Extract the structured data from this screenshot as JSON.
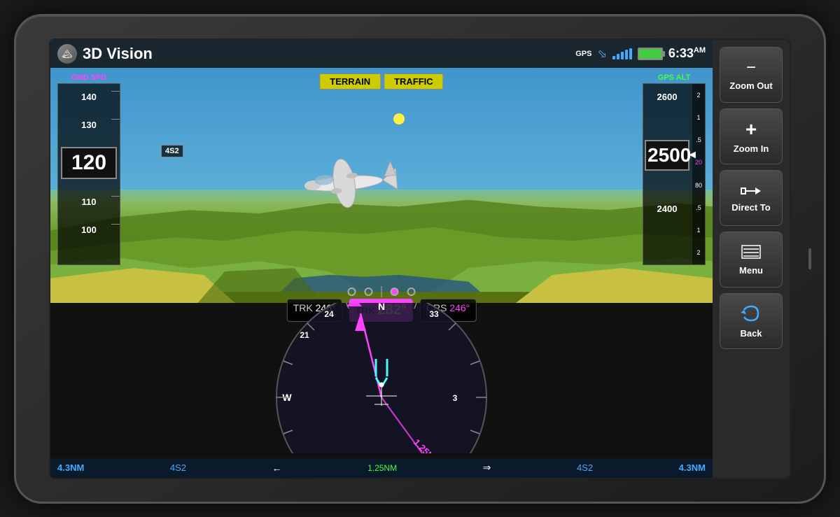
{
  "device": {
    "title": "3D Vision"
  },
  "header": {
    "title": "3D Vision",
    "gps_label": "GPS",
    "time": "6:33",
    "time_suffix": "AM"
  },
  "badges": {
    "terrain": "TERRAIN",
    "traffic": "TRAFFIC"
  },
  "speed": {
    "label": "GND SPD",
    "current": "120",
    "ticks": [
      "140",
      "130",
      "120",
      "110",
      "100"
    ]
  },
  "altitude": {
    "label": "GPS ALT",
    "current": "2500",
    "ticks": [
      "2600",
      "2500",
      "2400"
    ],
    "vert_nums": [
      "2",
      "1",
      ".5",
      "20",
      "80",
      ".5",
      "1",
      "2"
    ]
  },
  "nav": {
    "trk_left": {
      "label": "TRK",
      "value": "246°"
    },
    "trk_active": {
      "label": "TRK",
      "value": "282°"
    },
    "crs": {
      "label": "CRS",
      "value": "246°"
    }
  },
  "bottom_bar": {
    "left_dist": "4.3NM",
    "left_waypoint": "4S2",
    "left_arrow": "←",
    "center_dist": "1.25NM",
    "right_waypoint": "4S2",
    "right_arrow": "⇒",
    "right_dist": "4.3NM"
  },
  "waypoint": "4S2",
  "side_buttons": {
    "zoom_out": "Zoom Out",
    "zoom_in": "Zoom In",
    "direct_to": "Direct To",
    "menu": "Menu",
    "back": "Back"
  },
  "colors": {
    "magenta": "#ff44ff",
    "cyan": "#44ffff",
    "green": "#44ff44",
    "yellow": "#cccc00",
    "sky_top": "#3a7fbf",
    "sky_bottom": "#6ab8e0",
    "terrain_green": "#7ab040",
    "terrain_dark": "#4a7015"
  }
}
